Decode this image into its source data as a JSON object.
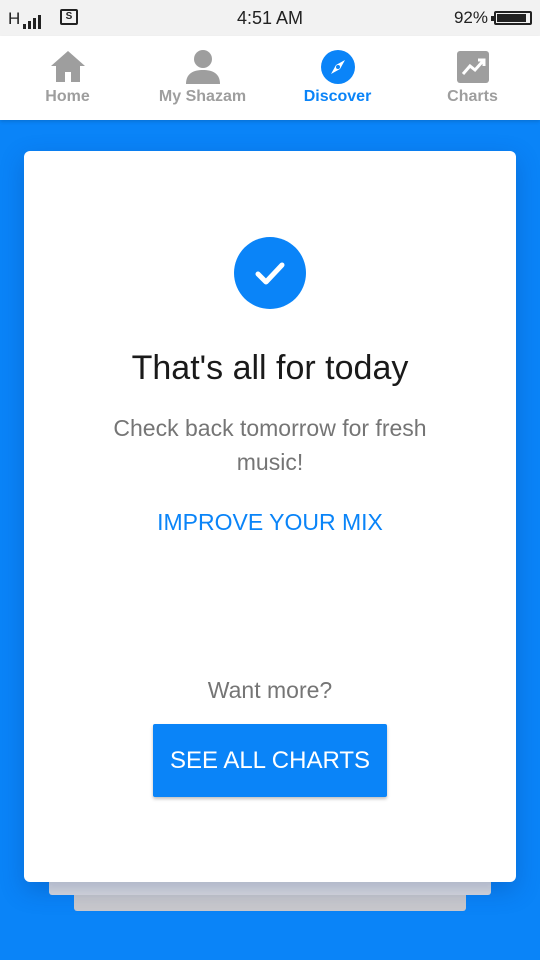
{
  "status_bar": {
    "network": "H",
    "sim_label": "S",
    "time": "4:51 AM",
    "battery_percent": "92%",
    "battery_level": 0.92
  },
  "nav": {
    "items": [
      {
        "label": "Home",
        "icon": "home-icon",
        "active": false
      },
      {
        "label": "My Shazam",
        "icon": "person-icon",
        "active": false
      },
      {
        "label": "Discover",
        "icon": "compass-icon",
        "active": true
      },
      {
        "label": "Charts",
        "icon": "trending-chart-icon",
        "active": false
      }
    ]
  },
  "card": {
    "icon": "check-icon",
    "title": "That's all for today",
    "subtitle": "Check back tomorrow for fresh music!",
    "improve_link": "IMPROVE YOUR MIX",
    "want_more": "Want more?",
    "see_all_button": "SEE ALL CHARTS"
  },
  "colors": {
    "accent": "#0a84f8",
    "background": "#0a84f8",
    "inactive": "#9e9e9e"
  }
}
